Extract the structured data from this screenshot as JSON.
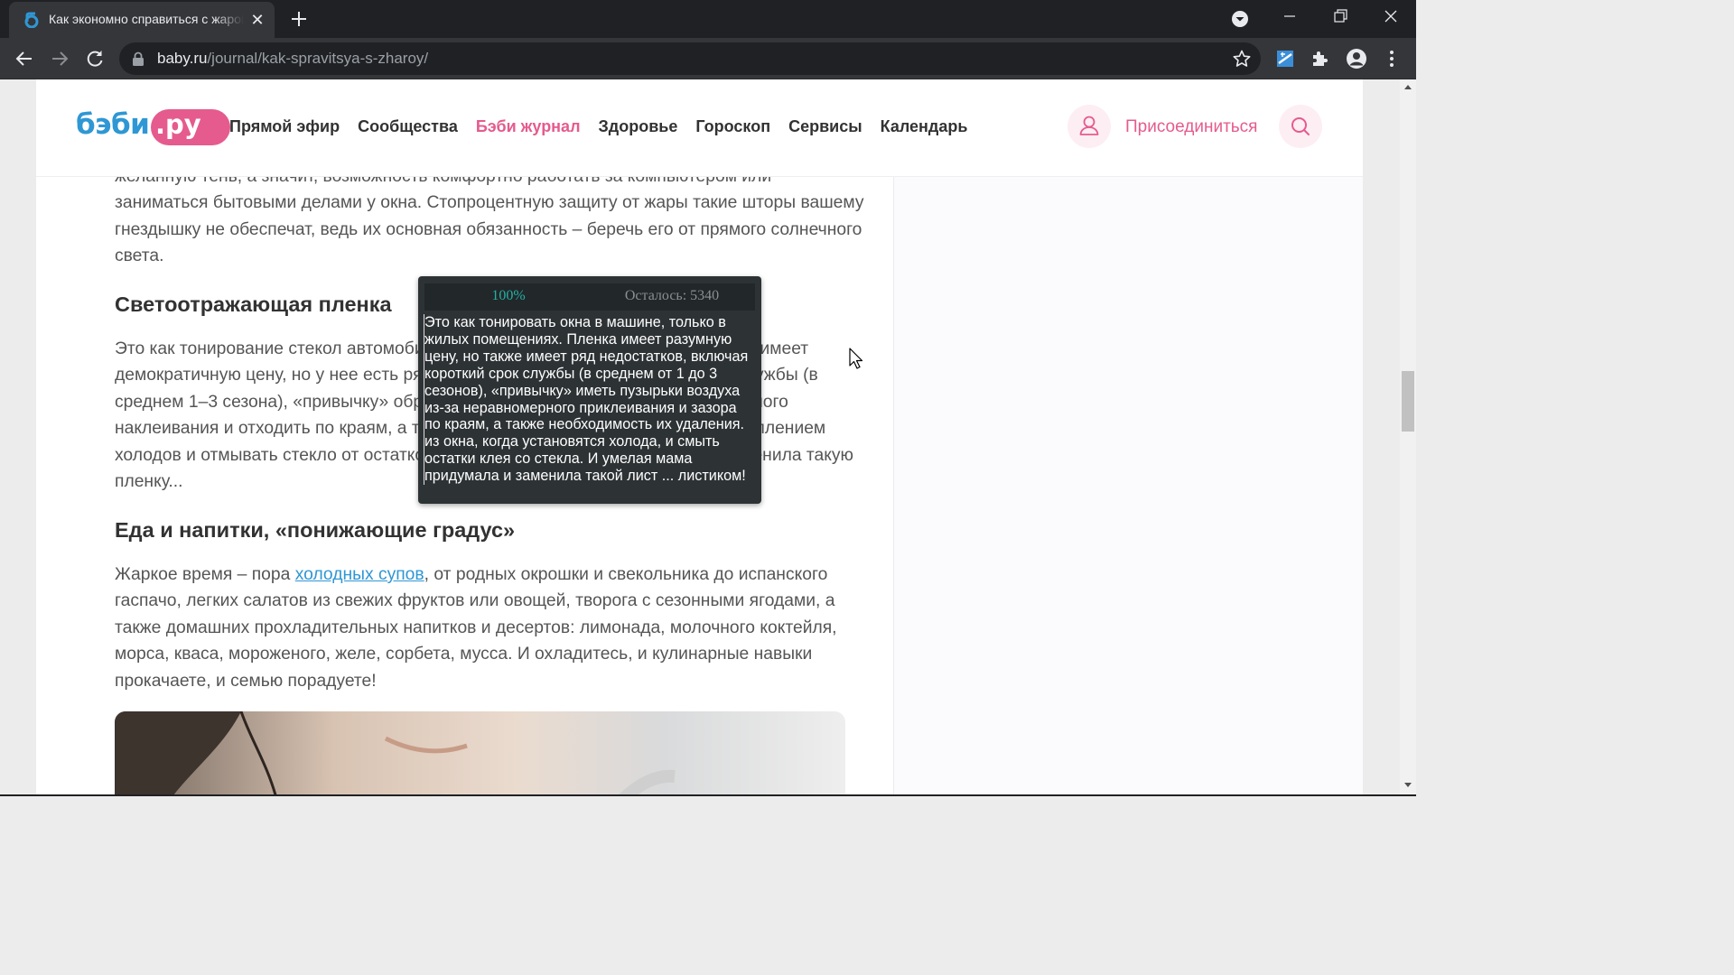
{
  "browser": {
    "tab_title": "Как экономно справиться с жарой",
    "url_host": "baby.ru",
    "url_path": "/journal/kak-spravitsya-s-zharoy/"
  },
  "header": {
    "logo_main": "бэби",
    "logo_suffix": ".ру",
    "nav": [
      "Прямой эфир",
      "Сообщества",
      "Бэби журнал",
      "Здоровье",
      "Гороскоп",
      "Сервисы",
      "Календарь"
    ],
    "join_label": "Присоединиться"
  },
  "article": {
    "p1": "желанную тень, а значит, возможность комфортно работать за компьютером или заниматься бытовыми делами у окна. Стопроцентную защиту от жары такие шторы вашему гнездышку не обеспечат, ведь их основная обязанность – беречь его от прямого солнечного света.",
    "h_film": "Светоотражающая пленка",
    "p2": "Это как тонирование стекол автомобиля, только в жилых помещениях. Пленка имеет демократичную цену, но у нее есть ряд недостатков, включая короткий срок службы (в среднем 1–3 сезона), «привычку» образовывать пузырьки воздуха из-за неровного наклеивания и отходить по краям, а также необходимость ее удаления с наступлением холодов и отмывать стекло от остатков клея. И умелая мама придумала и заменила такую пленку...",
    "h_food": "Еда и напитки, «понижающие градус»",
    "p3_before": "Жаркое время – пора ",
    "p3_link": "холодных супов",
    "p3_after": ", от родных окрошки и свекольника до испанского гаспачо, легких салатов из свежих фруктов или овощей, творога с сезонными ягодами, а также домашних прохладительных напитков и десертов: лимонада, молочного коктейля, морса, кваса, мороженого, желе, сорбета, мусса. И охладитесь, и кулинарные навыки прокачаете, и семью порадуете!"
  },
  "overlay": {
    "progress": "100%",
    "remaining": "Осталось: 5340",
    "text": "Это как тонировать окна в машине, только в жилых помещениях. Пленка имеет разумную цену, но также имеет ряд недостатков, включая короткий срок службы (в среднем от 1 до 3 сезонов), «привычку» иметь пузырьки воздуха из-за неравномерного приклеивания и зазора по краям, а также необходимость их удаления. из окна, когда установятся холода, и смыть остатки клея со стекла. И умелая мама придумала и заменила такой лист ... листиком!"
  },
  "colors": {
    "brand_pink": "#e55b8d",
    "brand_blue": "#2f97d4",
    "overlay_accent": "#25b0a4"
  }
}
